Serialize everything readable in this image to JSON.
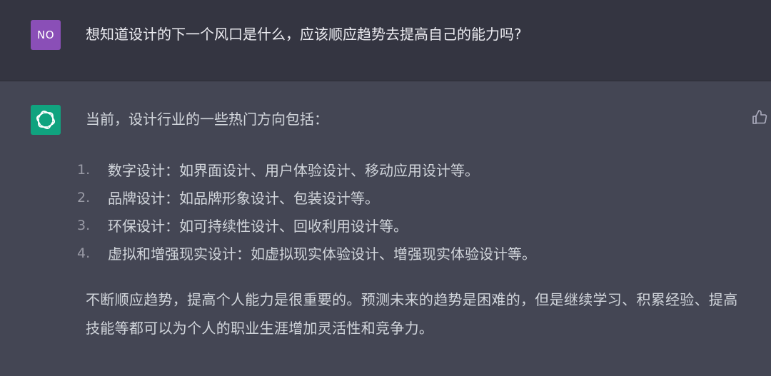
{
  "user": {
    "avatar_text": "NO",
    "message": "想知道设计的下一个风口是什么，应该顺应趋势去提高自己的能力吗?"
  },
  "assistant": {
    "avatar_icon": "openai-logo-icon",
    "feedback_icon": "thumbs-up-icon",
    "intro": "当前，设计行业的一些热门方向包括：",
    "list": [
      {
        "num": "1.",
        "text": "数字设计：如界面设计、用户体验设计、移动应用设计等。"
      },
      {
        "num": "2.",
        "text": "品牌设计：如品牌形象设计、包装设计等。"
      },
      {
        "num": "3.",
        "text": "环保设计：如可持续性设计、回收利用设计等。"
      },
      {
        "num": "4.",
        "text": "虚拟和增强现实设计：如虚拟现实体验设计、增强现实体验设计等。"
      }
    ],
    "paragraph": "不断顺应趋势，提高个人能力是很重要的。预测未来的趋势是困难的，但是继续学习、积累经验、提高技能等都可以为个人的职业生涯增加灵活性和竞争力。"
  },
  "colors": {
    "user_bg": "#343541",
    "assistant_bg": "#444654",
    "user_avatar": "#8a4fb7",
    "bot_avatar": "#10a37f"
  }
}
